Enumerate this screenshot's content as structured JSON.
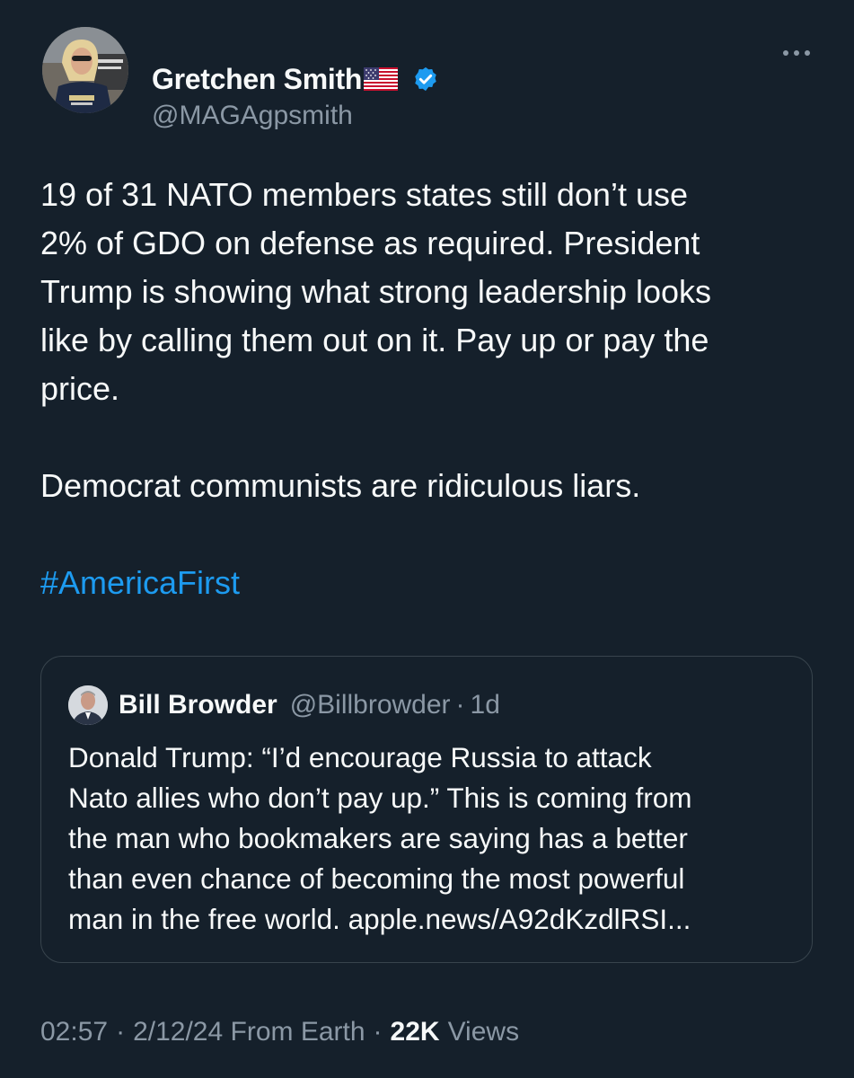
{
  "author": {
    "display_name": "Gretchen Smith",
    "handle": "@MAGAgpsmith",
    "verified": true,
    "avatar_icon": "profile-photo",
    "flag_icon": "us-flag-emoji"
  },
  "tweet": {
    "paragraph1_lines": [
      "19 of 31 NATO members states still don’t use",
      "2% of GDO on defense as required. President",
      "Trump is showing what strong leadership looks",
      "like by calling them out on it. Pay up or pay the",
      "price."
    ],
    "paragraph2": "Democrat communists are ridiculous liars.",
    "hashtag": "#AmericaFirst"
  },
  "quote": {
    "name": "Bill Browder",
    "handle": "@Billbrowder",
    "separator": "·",
    "time": "1d",
    "text_lines": [
      "Donald Trump: “I’d encourage Russia to attack",
      "Nato allies who don’t pay up.” This is coming from",
      "the man who bookmakers are saying has a better",
      "than even chance of becoming the most powerful",
      "man in the free world.  apple.news/A92dKzdlRSI..."
    ]
  },
  "meta": {
    "time": "02:57",
    "separator": "·",
    "date": "2/12/24 From Earth",
    "views_count": "22K",
    "views_label": "Views"
  },
  "colors": {
    "background": "#15202b",
    "text_primary": "#f7f9f9",
    "text_secondary": "#8b98a5",
    "accent_blue": "#1d9bf0",
    "border": "#38444d"
  }
}
